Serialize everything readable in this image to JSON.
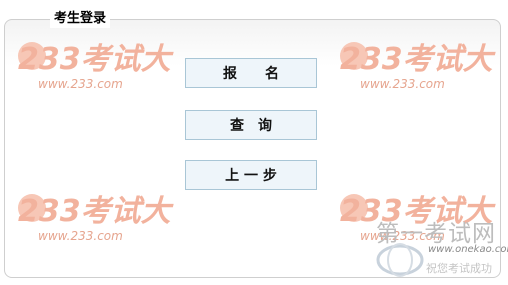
{
  "legend": "考生登录",
  "buttons": {
    "register": "报　　名",
    "query": "查　询",
    "back": "上 一 步"
  },
  "watermark": {
    "brand": "233考试大",
    "url": "www.233.com",
    "color": "#f4b8a6"
  },
  "corner_watermark": {
    "title": "第一考试网",
    "url": "www.onekao.com",
    "slogan": "祝您考试成功"
  }
}
